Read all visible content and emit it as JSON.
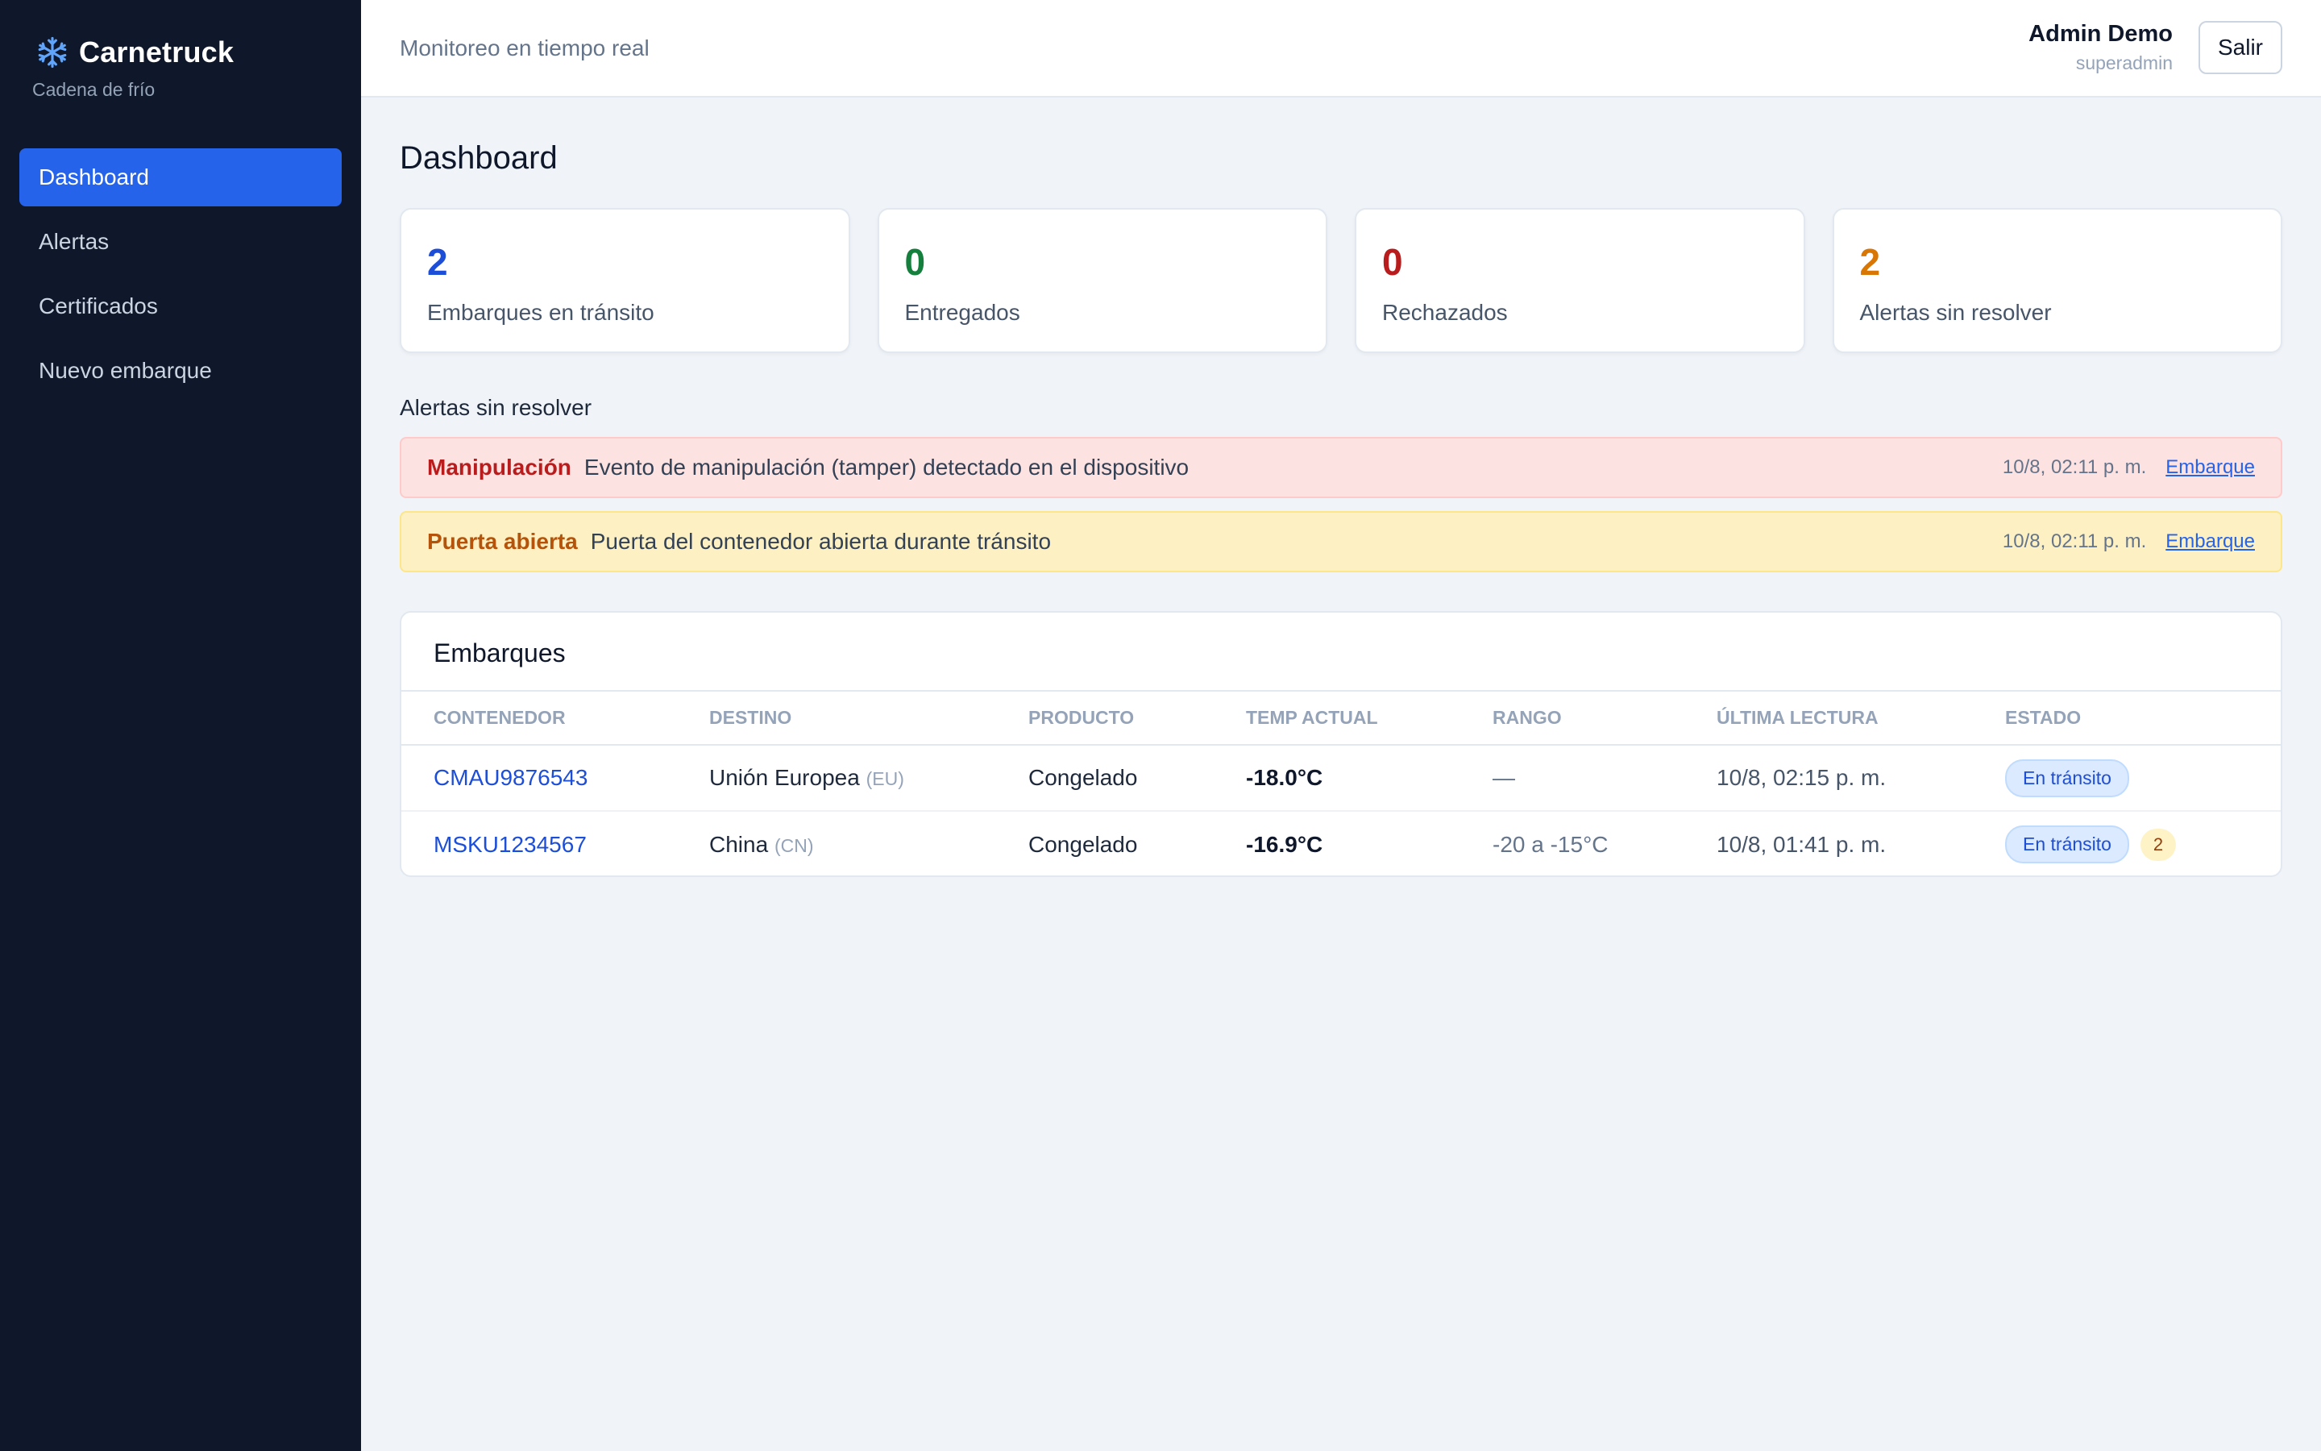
{
  "app": {
    "name": "Carnetruck",
    "subtitle": "Cadena de frío",
    "icon": "snowflake-icon"
  },
  "sidebar": {
    "items": [
      {
        "label": "Dashboard",
        "active": true
      },
      {
        "label": "Alertas",
        "active": false
      },
      {
        "label": "Certificados",
        "active": false
      },
      {
        "label": "Nuevo embarque",
        "active": false
      }
    ]
  },
  "header": {
    "title": "Monitoreo en tiempo real",
    "user_name": "Admin Demo",
    "user_role": "superadmin",
    "logout_label": "Salir"
  },
  "page": {
    "title": "Dashboard"
  },
  "stats": [
    {
      "value": "2",
      "label": "Embarques en tránsito",
      "color": "#1d4ed8"
    },
    {
      "value": "0",
      "label": "Entregados",
      "color": "#15803d"
    },
    {
      "value": "0",
      "label": "Rechazados",
      "color": "#b91c1c"
    },
    {
      "value": "2",
      "label": "Alertas sin resolver",
      "color": "#d97706"
    }
  ],
  "alerts": {
    "title": "Alertas sin resolver",
    "items": [
      {
        "type": "Manipulación",
        "message": "Evento de manipulación (tamper) detectado en el dispositivo",
        "time": "10/8, 02:11 p. m.",
        "link": "Embarque",
        "severity": "red"
      },
      {
        "type": "Puerta abierta",
        "message": "Puerta del contenedor abierta durante tránsito",
        "time": "10/8, 02:11 p. m.",
        "link": "Embarque",
        "severity": "yellow"
      }
    ]
  },
  "shipments": {
    "title": "Embarques",
    "columns": [
      "Contenedor",
      "Destino",
      "Producto",
      "Temp actual",
      "Rango",
      "Última lectura",
      "Estado"
    ],
    "rows": [
      {
        "container": "CMAU9876543",
        "destination": "Unión Europea",
        "destination_code": "(EU)",
        "product": "Congelado",
        "temp": "-18.0°C",
        "range": "—",
        "last_reading": "10/8, 02:15 p. m.",
        "status": "En tránsito",
        "alert_count": ""
      },
      {
        "container": "MSKU1234567",
        "destination": "China",
        "destination_code": "(CN)",
        "product": "Congelado",
        "temp": "-16.9°C",
        "range": "-20 a -15°C",
        "last_reading": "10/8, 01:41 p. m.",
        "status": "En tránsito",
        "alert_count": "2"
      }
    ]
  }
}
